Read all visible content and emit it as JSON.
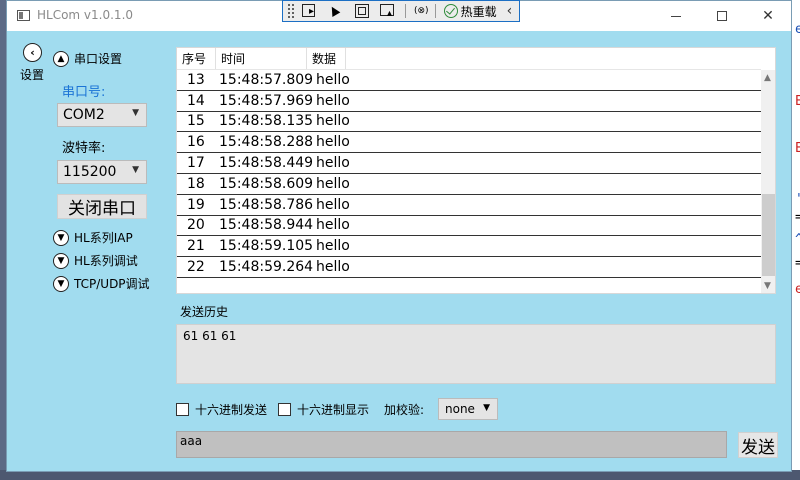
{
  "window": {
    "title": "HLCom v1.0.1.0"
  },
  "hot_reload": {
    "label": "热重载"
  },
  "settings": {
    "back_label": "设置",
    "serial_section": "串口设置",
    "port_label": "串口号:",
    "port_value": "COM2",
    "baud_label": "波特率:",
    "baud_value": "115200",
    "close_port_label": "关闭串口",
    "sections": [
      "HL系列IAP",
      "HL系列调试",
      "TCP/UDP调试"
    ]
  },
  "grid": {
    "columns": [
      "序号",
      "时间",
      "数据"
    ],
    "rows": [
      {
        "idx": "13",
        "time": "15:48:57.809",
        "data": "hello"
      },
      {
        "idx": "14",
        "time": "15:48:57.969",
        "data": "hello"
      },
      {
        "idx": "15",
        "time": "15:48:58.135",
        "data": "hello"
      },
      {
        "idx": "16",
        "time": "15:48:58.288",
        "data": "hello"
      },
      {
        "idx": "17",
        "time": "15:48:58.449",
        "data": "hello"
      },
      {
        "idx": "18",
        "time": "15:48:58.609",
        "data": "hello"
      },
      {
        "idx": "19",
        "time": "15:48:58.786",
        "data": "hello"
      },
      {
        "idx": "20",
        "time": "15:48:58.944",
        "data": "hello"
      },
      {
        "idx": "21",
        "time": "15:48:59.105",
        "data": "hello"
      },
      {
        "idx": "22",
        "time": "15:48:59.264",
        "data": "hello"
      }
    ]
  },
  "history": {
    "label": "发送历史",
    "content": "61 61 61"
  },
  "options": {
    "hex_send": "十六进制发送",
    "hex_display": "十六进制显示",
    "checksum_label": "加校验:",
    "checksum_value": "none"
  },
  "send": {
    "input_value": "aaa",
    "button_label": "发送"
  },
  "bg_editor_glyphs": [
    "e",
    "E",
    "E",
    "',",
    "=",
    "^",
    "=",
    "e"
  ],
  "colors": {
    "window_bg": "#a1dcef",
    "accent": "#1b74d6"
  }
}
